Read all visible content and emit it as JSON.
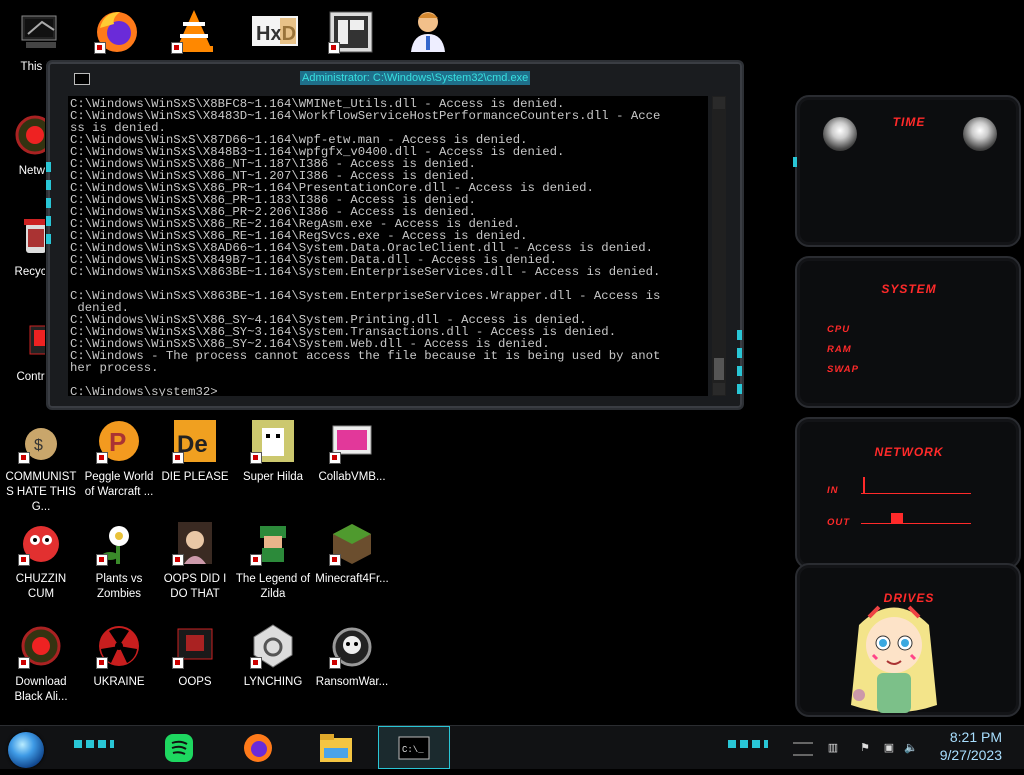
{
  "desktop": {
    "top_row": [
      {
        "label": "This PC",
        "icon": "this-pc-icon"
      },
      {
        "label": "",
        "icon": "firefox-icon"
      },
      {
        "label": "",
        "icon": "vlc-icon"
      },
      {
        "label": "",
        "icon": "hxd-icon"
      },
      {
        "label": "",
        "icon": "app-icon"
      },
      {
        "label": "",
        "icon": "doctor-icon"
      }
    ],
    "left_column": [
      {
        "label": "Netwo",
        "icon": "network-icon"
      },
      {
        "label": "Recycle",
        "icon": "recycle-bin-icon"
      },
      {
        "label": "Control",
        "icon": "control-panel-icon"
      }
    ],
    "grid": [
      {
        "label": "COMMUNISTS HATE THIS G...",
        "icon": "money-bag-icon"
      },
      {
        "label": "Peggle World of Warcraft ...",
        "icon": "peggle-icon"
      },
      {
        "label": "DIE PLEASE",
        "icon": "de-icon"
      },
      {
        "label": "Super Hilda",
        "icon": "hilda-icon"
      },
      {
        "label": "CollabVMB...",
        "icon": "collabvm-icon"
      },
      {
        "label": "CHUZZIN CUM",
        "icon": "chuzzle-icon"
      },
      {
        "label": "Plants vs Zombies",
        "icon": "pvz-icon"
      },
      {
        "label": "OOPS DID I DO THAT",
        "icon": "portrait-icon"
      },
      {
        "label": "The Legend of Zilda",
        "icon": "zilda-icon"
      },
      {
        "label": "Minecraft4Fr...",
        "icon": "minecraft-icon"
      },
      {
        "label": "Download Black Ali...",
        "icon": "alien-orb-icon"
      },
      {
        "label": "UKRAINE",
        "icon": "radiation-icon"
      },
      {
        "label": "OOPS",
        "icon": "oops-icon"
      },
      {
        "label": "LYNCHING",
        "icon": "lynching-icon"
      },
      {
        "label": "RansomWar...",
        "icon": "skull-icon"
      }
    ]
  },
  "cmd": {
    "title": "Administrator: C:\\Windows\\System32\\cmd.exe",
    "lines": [
      "C:\\Windows\\WinSxS\\X8BFC8~1.164\\WMINet_Utils.dll - Access is denied.",
      "C:\\Windows\\WinSxS\\X8483D~1.164\\WorkflowServiceHostPerformanceCounters.dll - Acce",
      "ss is denied.",
      "C:\\Windows\\WinSxS\\X87D66~1.164\\wpf-etw.man - Access is denied.",
      "C:\\Windows\\WinSxS\\X848B3~1.164\\wpfgfx_v0400.dll - Access is denied.",
      "C:\\Windows\\WinSxS\\X86_NT~1.187\\I386 - Access is denied.",
      "C:\\Windows\\WinSxS\\X86_NT~1.207\\I386 - Access is denied.",
      "C:\\Windows\\WinSxS\\X86_PR~1.164\\PresentationCore.dll - Access is denied.",
      "C:\\Windows\\WinSxS\\X86_PR~1.183\\I386 - Access is denied.",
      "C:\\Windows\\WinSxS\\X86_PR~2.206\\I386 - Access is denied.",
      "C:\\Windows\\WinSxS\\X86_RE~2.164\\RegAsm.exe - Access is denied.",
      "C:\\Windows\\WinSxS\\X86_RE~1.164\\RegSvcs.exe - Access is denied.",
      "C:\\Windows\\WinSxS\\X8AD66~1.164\\System.Data.OracleClient.dll - Access is denied.",
      "C:\\Windows\\WinSxS\\X849B7~1.164\\System.Data.dll - Access is denied.",
      "C:\\Windows\\WinSxS\\X863BE~1.164\\System.EnterpriseServices.dll - Access is denied.",
      "",
      "C:\\Windows\\WinSxS\\X863BE~1.164\\System.EnterpriseServices.Wrapper.dll - Access is",
      " denied.",
      "C:\\Windows\\WinSxS\\X86_SY~4.164\\System.Printing.dll - Access is denied.",
      "C:\\Windows\\WinSxS\\X86_SY~3.164\\System.Transactions.dll - Access is denied.",
      "C:\\Windows\\WinSxS\\X86_SY~2.164\\System.Web.dll - Access is denied.",
      "C:\\Windows - The process cannot access the file because it is being used by anot",
      "her process.",
      ""
    ],
    "prompt": "C:\\Windows\\system32>"
  },
  "widgets": {
    "time": {
      "title": "TIME"
    },
    "system": {
      "title": "SYSTEM",
      "labels": [
        "CPU",
        "RAM",
        "SWAP"
      ]
    },
    "network": {
      "title": "NETWORK",
      "labels": [
        "IN",
        "OUT"
      ]
    },
    "drives": {
      "title": "DRIVES"
    }
  },
  "taskbar": {
    "apps": [
      "spotify-icon",
      "firefox-icon",
      "file-explorer-icon",
      "cmd-icon"
    ],
    "clock_time": "8:21 PM",
    "clock_date": "9/27/2023"
  },
  "colors": {
    "accent_red": "#ff2a2a",
    "accent_cyan": "#29c6d6",
    "clock": "#a9dfff"
  }
}
